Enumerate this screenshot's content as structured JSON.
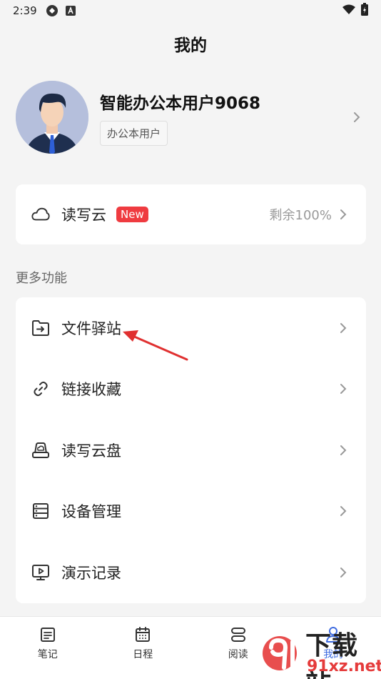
{
  "status_bar": {
    "time": "2:39"
  },
  "page_title": "我的",
  "profile": {
    "name": "智能办公本用户9068",
    "tag": "办公本用户"
  },
  "cloud": {
    "label": "读写云",
    "badge": "New",
    "remaining": "剩余100%"
  },
  "section_title": "更多功能",
  "more_items": [
    {
      "label": "文件驿站",
      "icon": "folder-transfer-icon"
    },
    {
      "label": "链接收藏",
      "icon": "link-icon"
    },
    {
      "label": "读写云盘",
      "icon": "cloud-drive-icon"
    },
    {
      "label": "设备管理",
      "icon": "device-list-icon"
    },
    {
      "label": "演示记录",
      "icon": "presentation-icon"
    }
  ],
  "tabs": [
    {
      "label": "笔记",
      "icon": "note-icon",
      "active": false
    },
    {
      "label": "日程",
      "icon": "calendar-icon",
      "active": false
    },
    {
      "label": "阅读",
      "icon": "reading-icon",
      "active": false
    },
    {
      "label": "我的",
      "icon": "profile-icon",
      "active": true
    }
  ],
  "watermark": {
    "line1": "下载站",
    "line2": "91xz.net"
  },
  "colors": {
    "accent": "#3e6be0",
    "badge": "#ef3b40",
    "background": "#f4f4f4"
  }
}
